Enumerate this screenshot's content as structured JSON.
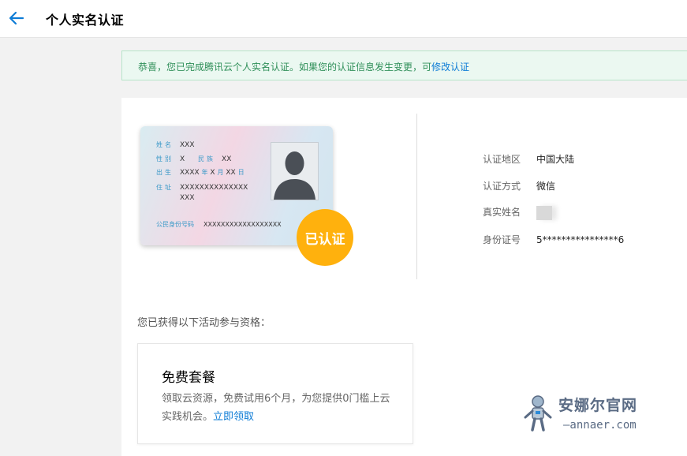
{
  "header": {
    "title": "个人实名认证"
  },
  "notice": {
    "text": "恭喜，您已完成腾讯云个人实名认证。如果您的认证信息发生变更，可",
    "link": "修改认证"
  },
  "id_card": {
    "name_label": "姓名",
    "name_value": "XXX",
    "gender_label": "性别",
    "gender_value": "X",
    "ethnicity_label": "民族",
    "ethnicity_value": "XX",
    "birth_label": "出生",
    "birth_year": "XXXX",
    "year_char": "年",
    "birth_month": "X",
    "month_char": "月",
    "birth_day": "XX",
    "day_char": "日",
    "address_label": "住址",
    "address_line1": "XXXXXXXXXXXXXX",
    "address_line2": "XXX",
    "id_label": "公民身份号码",
    "id_value": "XXXXXXXXXXXXXXXXXX",
    "badge": "已认证"
  },
  "info": [
    {
      "label": "认证地区",
      "value": "中国大陆"
    },
    {
      "label": "认证方式",
      "value": "微信"
    },
    {
      "label": "真实姓名",
      "value": ""
    },
    {
      "label": "身份证号",
      "value": "5****************6"
    }
  ],
  "activity": {
    "title": "您已获得以下活动参与资格：",
    "card_title": "免费套餐",
    "desc": "领取云资源，免费试用6个月，为您提供0门槛上云实践机会。",
    "link": "立即领取"
  },
  "watermark": {
    "title": "安娜尔官网",
    "sub": "—annaer.com"
  },
  "colors": {
    "accent": "#0e7cd6",
    "badge": "#ffb10d",
    "notice_bg": "#ebf8f1",
    "notice_text": "#2f8f59"
  }
}
